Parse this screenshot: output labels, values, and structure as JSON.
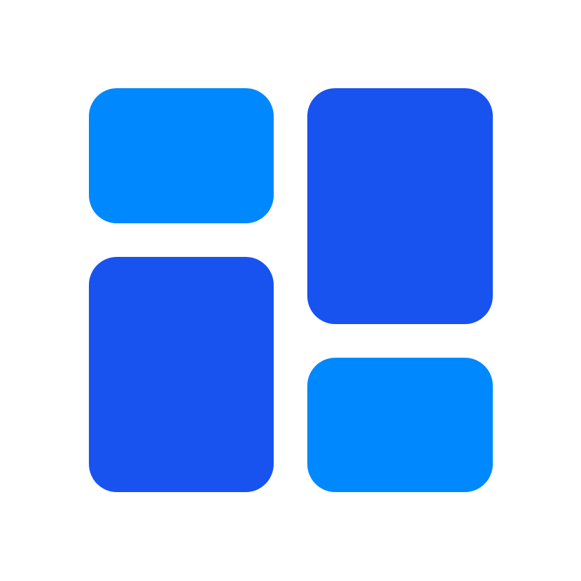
{
  "icon": {
    "name": "dashboard-grid-icon",
    "colors": {
      "light": "#0088FF",
      "dark": "#1853F0",
      "background": "#FFFFFF"
    },
    "tiles": [
      {
        "name": "tile-top-left",
        "color": "#0088FF"
      },
      {
        "name": "tile-bottom-left",
        "color": "#1853F0"
      },
      {
        "name": "tile-top-right",
        "color": "#1853F0"
      },
      {
        "name": "tile-bottom-right",
        "color": "#0088FF"
      }
    ]
  }
}
